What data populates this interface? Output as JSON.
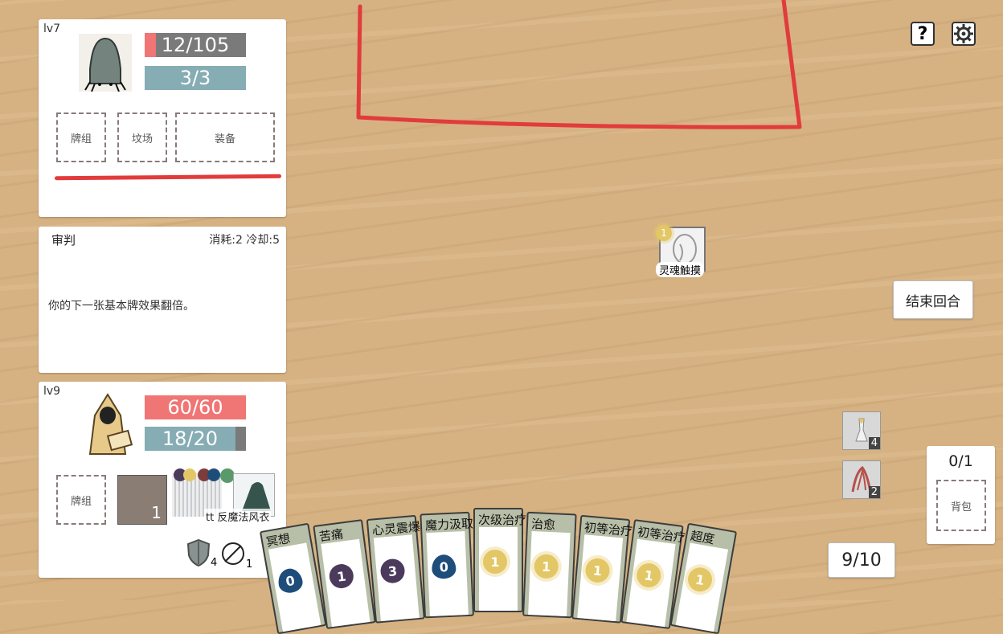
{
  "enemy": {
    "level": "lv7",
    "hp": "12/105",
    "hp_fill": 0.114,
    "shield": "3/3",
    "slots": {
      "deck": "牌组",
      "graveyard": "坟场",
      "equipment": "装备"
    }
  },
  "skill_card": {
    "name": "审判",
    "meta": "消耗:2 冷却:5",
    "description": "你的下一张基本牌效果翻倍。"
  },
  "player": {
    "level": "lv9",
    "hp": "60/60",
    "mana": "18/20",
    "mana_fill": 0.9,
    "slots": {
      "deck": "牌组",
      "graveyard_count": "1"
    },
    "equipped_label": "tt 反魔法风衣",
    "armor": "4",
    "resist": "1"
  },
  "field_card": {
    "name": "灵魂触摸",
    "cost": "1"
  },
  "end_turn": "结束回合",
  "help_icon": "?",
  "side_stack": [
    {
      "count": "4"
    },
    {
      "count": "2"
    }
  ],
  "backpack": {
    "count": "0/1",
    "label": "背包"
  },
  "hand_count": "9/10",
  "hand": [
    {
      "name": "冥想",
      "cost": "0",
      "type": "water"
    },
    {
      "name": "苦痛",
      "cost": "1",
      "type": "dark"
    },
    {
      "name": "心灵震爆",
      "cost": "3",
      "type": "dark"
    },
    {
      "name": "魔力汲取",
      "cost": "0",
      "type": "water"
    },
    {
      "name": "次级治疗",
      "cost": "1",
      "type": "sun"
    },
    {
      "name": "治愈",
      "cost": "1",
      "type": "sun"
    },
    {
      "name": "初等治疗",
      "cost": "1",
      "type": "sun"
    },
    {
      "name": "初等治疗",
      "cost": "1",
      "type": "sun"
    },
    {
      "name": "超度",
      "cost": "1",
      "type": "sun"
    }
  ],
  "colors": {
    "hp_red": "#f07575",
    "shield_blue": "#86acb4",
    "bar_bg": "#7a7a7a",
    "annotation_red": "#e23b3b"
  }
}
